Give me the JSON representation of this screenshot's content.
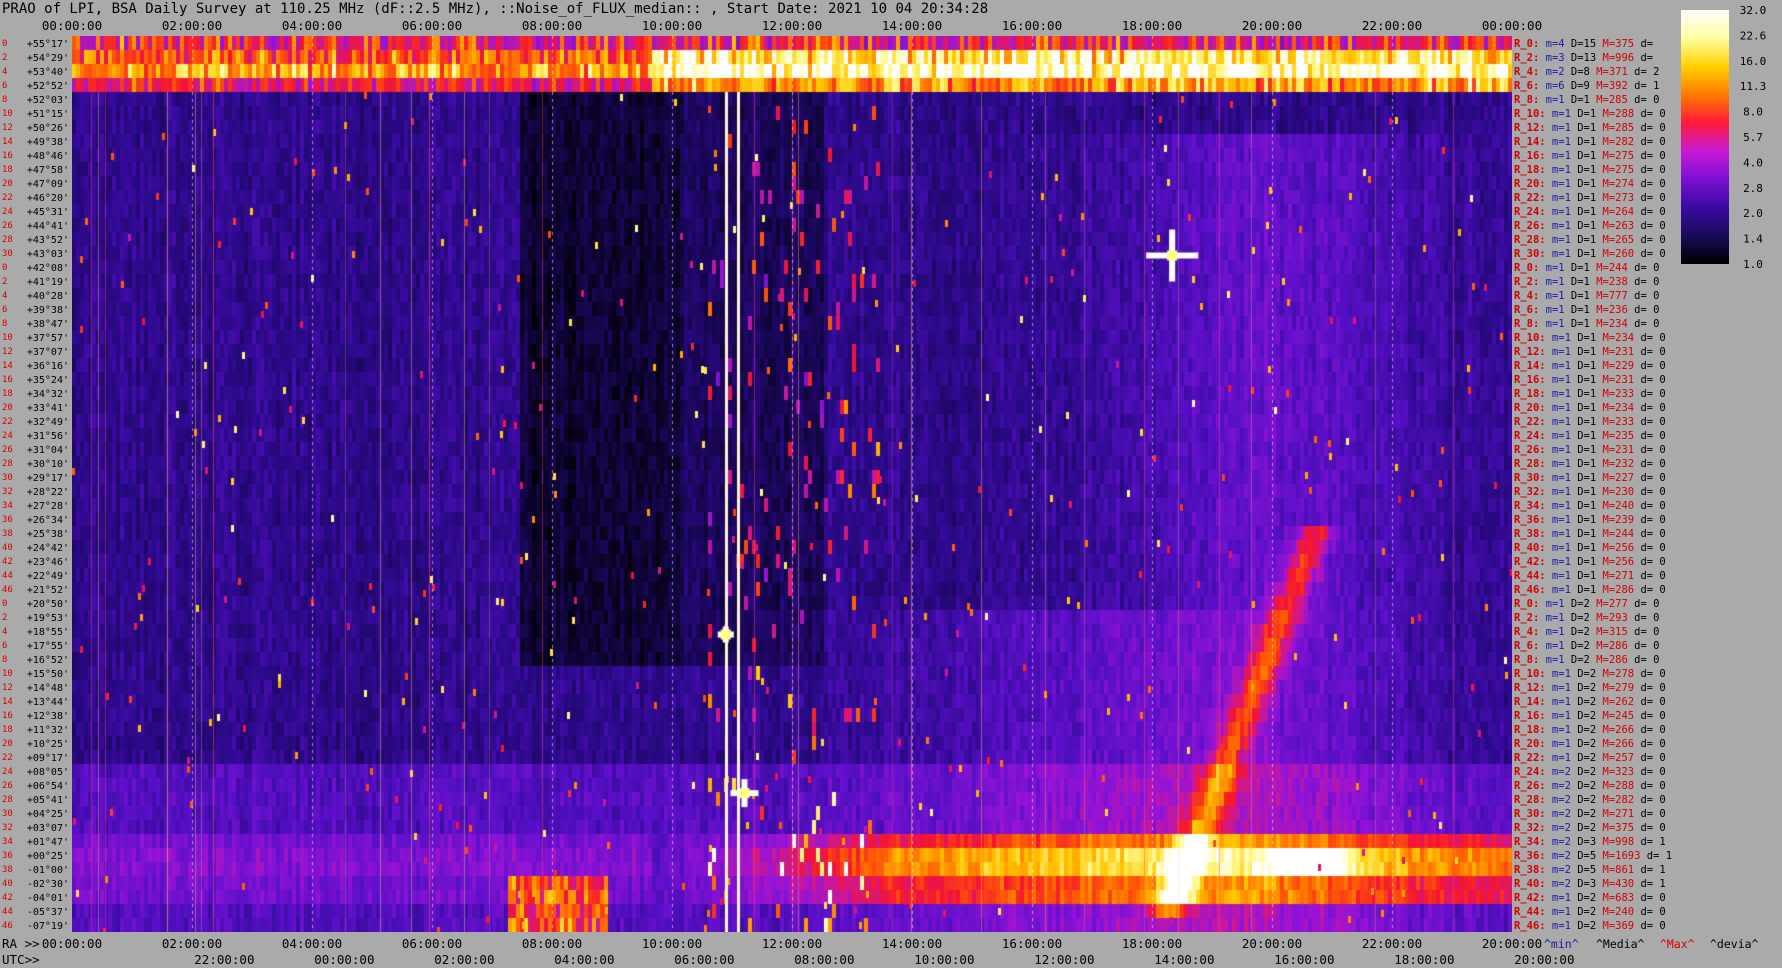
{
  "title": "PRAO of LPI, BSA Daily Survey at 110.25 MHz (dF::2.5 MHz), ::Noise_of_FLUX_median:: , Start Date: 2021 10 04 20:34:28",
  "chart_data": {
    "type": "heatmap",
    "x_top_ticks": [
      "00:00:00",
      "02:00:00",
      "04:00:00",
      "06:00:00",
      "08:00:00",
      "10:00:00",
      "12:00:00",
      "14:00:00",
      "16:00:00",
      "18:00:00",
      "20:00:00",
      "22:00:00",
      "00:00:00"
    ],
    "x_bottom_prefix": "RA >>",
    "x_bottom_ticks": [
      "00:00:00",
      "02:00:00",
      "04:00:00",
      "06:00:00",
      "08:00:00",
      "10:00:00",
      "12:00:00",
      "14:00:00",
      "16:00:00",
      "18:00:00",
      "20:00:00",
      "22:00:00",
      "20:00:00"
    ],
    "utc_prefix": "UTC>>",
    "utc_ticks": [
      "22:00:00",
      "00:00:00",
      "02:00:00",
      "04:00:00",
      "06:00:00",
      "08:00:00",
      "10:00:00",
      "12:00:00",
      "14:00:00",
      "16:00:00",
      "18:00:00",
      "20:00:00"
    ],
    "declinations": [
      "+55°17'",
      "+54°29'",
      "+53°40'",
      "+52°52'",
      "+52°03'",
      "+51°15'",
      "+50°26'",
      "+49°38'",
      "+48°46'",
      "+47°58'",
      "+47°09'",
      "+46°20'",
      "+45°31'",
      "+44°41'",
      "+43°52'",
      "+43°03'",
      "+42°08'",
      "+41°19'",
      "+40°28'",
      "+39°38'",
      "+38°47'",
      "+37°57'",
      "+37°07'",
      "+36°16'",
      "+35°24'",
      "+34°32'",
      "+33°41'",
      "+32°49'",
      "+31°56'",
      "+31°04'",
      "+30°10'",
      "+29°17'",
      "+28°22'",
      "+27°28'",
      "+26°34'",
      "+25°38'",
      "+24°42'",
      "+23°46'",
      "+22°49'",
      "+21°52'",
      "+20°50'",
      "+19°53'",
      "+18°55'",
      "+17°55'",
      "+16°52'",
      "+15°50'",
      "+14°48'",
      "+13°44'",
      "+12°38'",
      "+11°32'",
      "+10°25'",
      "+09°17'",
      "+08°05'",
      "+06°54'",
      "+05°41'",
      "+04°25'",
      "+03°07'",
      "+01°47'",
      "+00°25'",
      "-01°00'",
      "-02°30'",
      "-04°01'",
      "-05°37'",
      "-07°19'"
    ],
    "row_index_labels": [
      "0",
      "2",
      "4",
      "6",
      "8",
      "10",
      "12",
      "14",
      "16",
      "18",
      "20",
      "22",
      "24",
      "26",
      "28",
      "30",
      "0",
      "2",
      "4",
      "6",
      "8",
      "10",
      "12",
      "14",
      "16",
      "18",
      "20",
      "22",
      "24",
      "26",
      "28",
      "30",
      "32",
      "34",
      "36",
      "38",
      "40",
      "42",
      "44",
      "46",
      "0",
      "2",
      "4",
      "6",
      "8",
      "10",
      "12",
      "14",
      "16",
      "18",
      "20",
      "22",
      "24",
      "26",
      "28",
      "30",
      "32",
      "34",
      "36",
      "38",
      "40",
      "42",
      "44",
      "46"
    ],
    "colorbar": {
      "ticks": [
        "32.0",
        "22.6",
        "16.0",
        "11.3",
        "8.0",
        "5.7",
        "4.0",
        "2.8",
        "2.0",
        "1.4",
        "1.0"
      ],
      "scale": "log",
      "range": [
        1.0,
        32.0
      ]
    },
    "stats_legend": {
      "min": "^min^",
      "median": "^Media^",
      "max": "^Max^",
      "dev": "^devia^"
    },
    "stats": [
      {
        "name": "R_0:",
        "m": "m=4",
        "d": "D=15",
        "max": "M=375",
        "dev": "d="
      },
      {
        "name": "R_2:",
        "m": "m=3",
        "d": "D=13",
        "max": "M=996",
        "dev": "d="
      },
      {
        "name": "R_4:",
        "m": "m=2",
        "d": "D=8",
        "max": "M=371",
        "dev": "d= 2"
      },
      {
        "name": "R_6:",
        "m": "m=6",
        "d": "D=9",
        "max": "M=392",
        "dev": "d= 1"
      },
      {
        "name": "R_8:",
        "m": "m=1",
        "d": "D=1",
        "max": "M=285",
        "dev": "d= 0"
      },
      {
        "name": "R_10:",
        "m": "m=1",
        "d": "D=1",
        "max": "M=288",
        "dev": "d= 0"
      },
      {
        "name": "R_12:",
        "m": "m=1",
        "d": "D=1",
        "max": "M=285",
        "dev": "d= 0"
      },
      {
        "name": "R_14:",
        "m": "m=1",
        "d": "D=1",
        "max": "M=282",
        "dev": "d= 0"
      },
      {
        "name": "R_16:",
        "m": "m=1",
        "d": "D=1",
        "max": "M=275",
        "dev": "d= 0"
      },
      {
        "name": "R_18:",
        "m": "m=1",
        "d": "D=1",
        "max": "M=275",
        "dev": "d= 0"
      },
      {
        "name": "R_20:",
        "m": "m=1",
        "d": "D=1",
        "max": "M=274",
        "dev": "d= 0"
      },
      {
        "name": "R_22:",
        "m": "m=1",
        "d": "D=1",
        "max": "M=273",
        "dev": "d= 0"
      },
      {
        "name": "R_24:",
        "m": "m=1",
        "d": "D=1",
        "max": "M=264",
        "dev": "d= 0"
      },
      {
        "name": "R_26:",
        "m": "m=1",
        "d": "D=1",
        "max": "M=263",
        "dev": "d= 0"
      },
      {
        "name": "R_28:",
        "m": "m=1",
        "d": "D=1",
        "max": "M=265",
        "dev": "d= 0"
      },
      {
        "name": "R_30:",
        "m": "m=1",
        "d": "D=1",
        "max": "M=260",
        "dev": "d= 0"
      },
      {
        "name": "R_0:",
        "m": "m=1",
        "d": "D=1",
        "max": "M=244",
        "dev": "d= 0"
      },
      {
        "name": "R_2:",
        "m": "m=1",
        "d": "D=1",
        "max": "M=238",
        "dev": "d= 0"
      },
      {
        "name": "R_4:",
        "m": "m=1",
        "d": "D=1",
        "max": "M=777",
        "dev": "d= 0"
      },
      {
        "name": "R_6:",
        "m": "m=1",
        "d": "D=1",
        "max": "M=236",
        "dev": "d= 0"
      },
      {
        "name": "R_8:",
        "m": "m=1",
        "d": "D=1",
        "max": "M=234",
        "dev": "d= 0"
      },
      {
        "name": "R_10:",
        "m": "m=1",
        "d": "D=1",
        "max": "M=234",
        "dev": "d= 0"
      },
      {
        "name": "R_12:",
        "m": "m=1",
        "d": "D=1",
        "max": "M=231",
        "dev": "d= 0"
      },
      {
        "name": "R_14:",
        "m": "m=1",
        "d": "D=1",
        "max": "M=229",
        "dev": "d= 0"
      },
      {
        "name": "R_16:",
        "m": "m=1",
        "d": "D=1",
        "max": "M=231",
        "dev": "d= 0"
      },
      {
        "name": "R_18:",
        "m": "m=1",
        "d": "D=1",
        "max": "M=233",
        "dev": "d= 0"
      },
      {
        "name": "R_20:",
        "m": "m=1",
        "d": "D=1",
        "max": "M=234",
        "dev": "d= 0"
      },
      {
        "name": "R_22:",
        "m": "m=1",
        "d": "D=1",
        "max": "M=233",
        "dev": "d= 0"
      },
      {
        "name": "R_24:",
        "m": "m=1",
        "d": "D=1",
        "max": "M=235",
        "dev": "d= 0"
      },
      {
        "name": "R_26:",
        "m": "m=1",
        "d": "D=1",
        "max": "M=231",
        "dev": "d= 0"
      },
      {
        "name": "R_28:",
        "m": "m=1",
        "d": "D=1",
        "max": "M=232",
        "dev": "d= 0"
      },
      {
        "name": "R_30:",
        "m": "m=1",
        "d": "D=1",
        "max": "M=227",
        "dev": "d= 0"
      },
      {
        "name": "R_32:",
        "m": "m=1",
        "d": "D=1",
        "max": "M=230",
        "dev": "d= 0"
      },
      {
        "name": "R_34:",
        "m": "m=1",
        "d": "D=1",
        "max": "M=240",
        "dev": "d= 0"
      },
      {
        "name": "R_36:",
        "m": "m=1",
        "d": "D=1",
        "max": "M=239",
        "dev": "d= 0"
      },
      {
        "name": "R_38:",
        "m": "m=1",
        "d": "D=1",
        "max": "M=244",
        "dev": "d= 0"
      },
      {
        "name": "R_40:",
        "m": "m=1",
        "d": "D=1",
        "max": "M=256",
        "dev": "d= 0"
      },
      {
        "name": "R_42:",
        "m": "m=1",
        "d": "D=1",
        "max": "M=256",
        "dev": "d= 0"
      },
      {
        "name": "R_44:",
        "m": "m=1",
        "d": "D=1",
        "max": "M=271",
        "dev": "d= 0"
      },
      {
        "name": "R_46:",
        "m": "m=1",
        "d": "D=1",
        "max": "M=286",
        "dev": "d= 0"
      },
      {
        "name": "R_0:",
        "m": "m=1",
        "d": "D=2",
        "max": "M=277",
        "dev": "d= 0"
      },
      {
        "name": "R_2:",
        "m": "m=1",
        "d": "D=2",
        "max": "M=293",
        "dev": "d= 0"
      },
      {
        "name": "R_4:",
        "m": "m=1",
        "d": "D=2",
        "max": "M=315",
        "dev": "d= 0"
      },
      {
        "name": "R_6:",
        "m": "m=1",
        "d": "D=2",
        "max": "M=286",
        "dev": "d= 0"
      },
      {
        "name": "R_8:",
        "m": "m=1",
        "d": "D=2",
        "max": "M=286",
        "dev": "d= 0"
      },
      {
        "name": "R_10:",
        "m": "m=1",
        "d": "D=2",
        "max": "M=278",
        "dev": "d= 0"
      },
      {
        "name": "R_12:",
        "m": "m=1",
        "d": "D=2",
        "max": "M=279",
        "dev": "d= 0"
      },
      {
        "name": "R_14:",
        "m": "m=1",
        "d": "D=2",
        "max": "M=262",
        "dev": "d= 0"
      },
      {
        "name": "R_16:",
        "m": "m=1",
        "d": "D=2",
        "max": "M=245",
        "dev": "d= 0"
      },
      {
        "name": "R_18:",
        "m": "m=1",
        "d": "D=2",
        "max": "M=266",
        "dev": "d= 0"
      },
      {
        "name": "R_20:",
        "m": "m=1",
        "d": "D=2",
        "max": "M=266",
        "dev": "d= 0"
      },
      {
        "name": "R_22:",
        "m": "m=1",
        "d": "D=2",
        "max": "M=257",
        "dev": "d= 0"
      },
      {
        "name": "R_24:",
        "m": "m=2",
        "d": "D=2",
        "max": "M=323",
        "dev": "d= 0"
      },
      {
        "name": "R_26:",
        "m": "m=2",
        "d": "D=2",
        "max": "M=288",
        "dev": "d= 0"
      },
      {
        "name": "R_28:",
        "m": "m=2",
        "d": "D=2",
        "max": "M=282",
        "dev": "d= 0"
      },
      {
        "name": "R_30:",
        "m": "m=2",
        "d": "D=2",
        "max": "M=271",
        "dev": "d= 0"
      },
      {
        "name": "R_32:",
        "m": "m=2",
        "d": "D=2",
        "max": "M=375",
        "dev": "d= 0"
      },
      {
        "name": "R_34:",
        "m": "m=2",
        "d": "D=3",
        "max": "M=998",
        "dev": "d= 1"
      },
      {
        "name": "R_36:",
        "m": "m=2",
        "d": "D=5",
        "max": "M=1693",
        "dev": "d= 1"
      },
      {
        "name": "R_38:",
        "m": "m=2",
        "d": "D=5",
        "max": "M=861",
        "dev": "d= 1"
      },
      {
        "name": "R_40:",
        "m": "m=2",
        "d": "D=3",
        "max": "M=430",
        "dev": "d= 1"
      },
      {
        "name": "R_42:",
        "m": "m=1",
        "d": "D=2",
        "max": "M=683",
        "dev": "d= 0"
      },
      {
        "name": "R_44:",
        "m": "m=1",
        "d": "D=2",
        "max": "M=240",
        "dev": "d= 0"
      },
      {
        "name": "R_46:",
        "m": "m=1",
        "d": "D=2",
        "max": "M=369",
        "dev": "d= 0"
      }
    ]
  },
  "colors": {
    "background": "#aaaaaa",
    "label_red": "#d40000",
    "label_blue": "#1a1aa8",
    "colormap": [
      "#000000",
      "#1a0a5a",
      "#3a0aa0",
      "#7a10d0",
      "#c81ad8",
      "#ff1a3a",
      "#ff7a00",
      "#ffd000",
      "#ffffa0",
      "#ffffff"
    ]
  }
}
